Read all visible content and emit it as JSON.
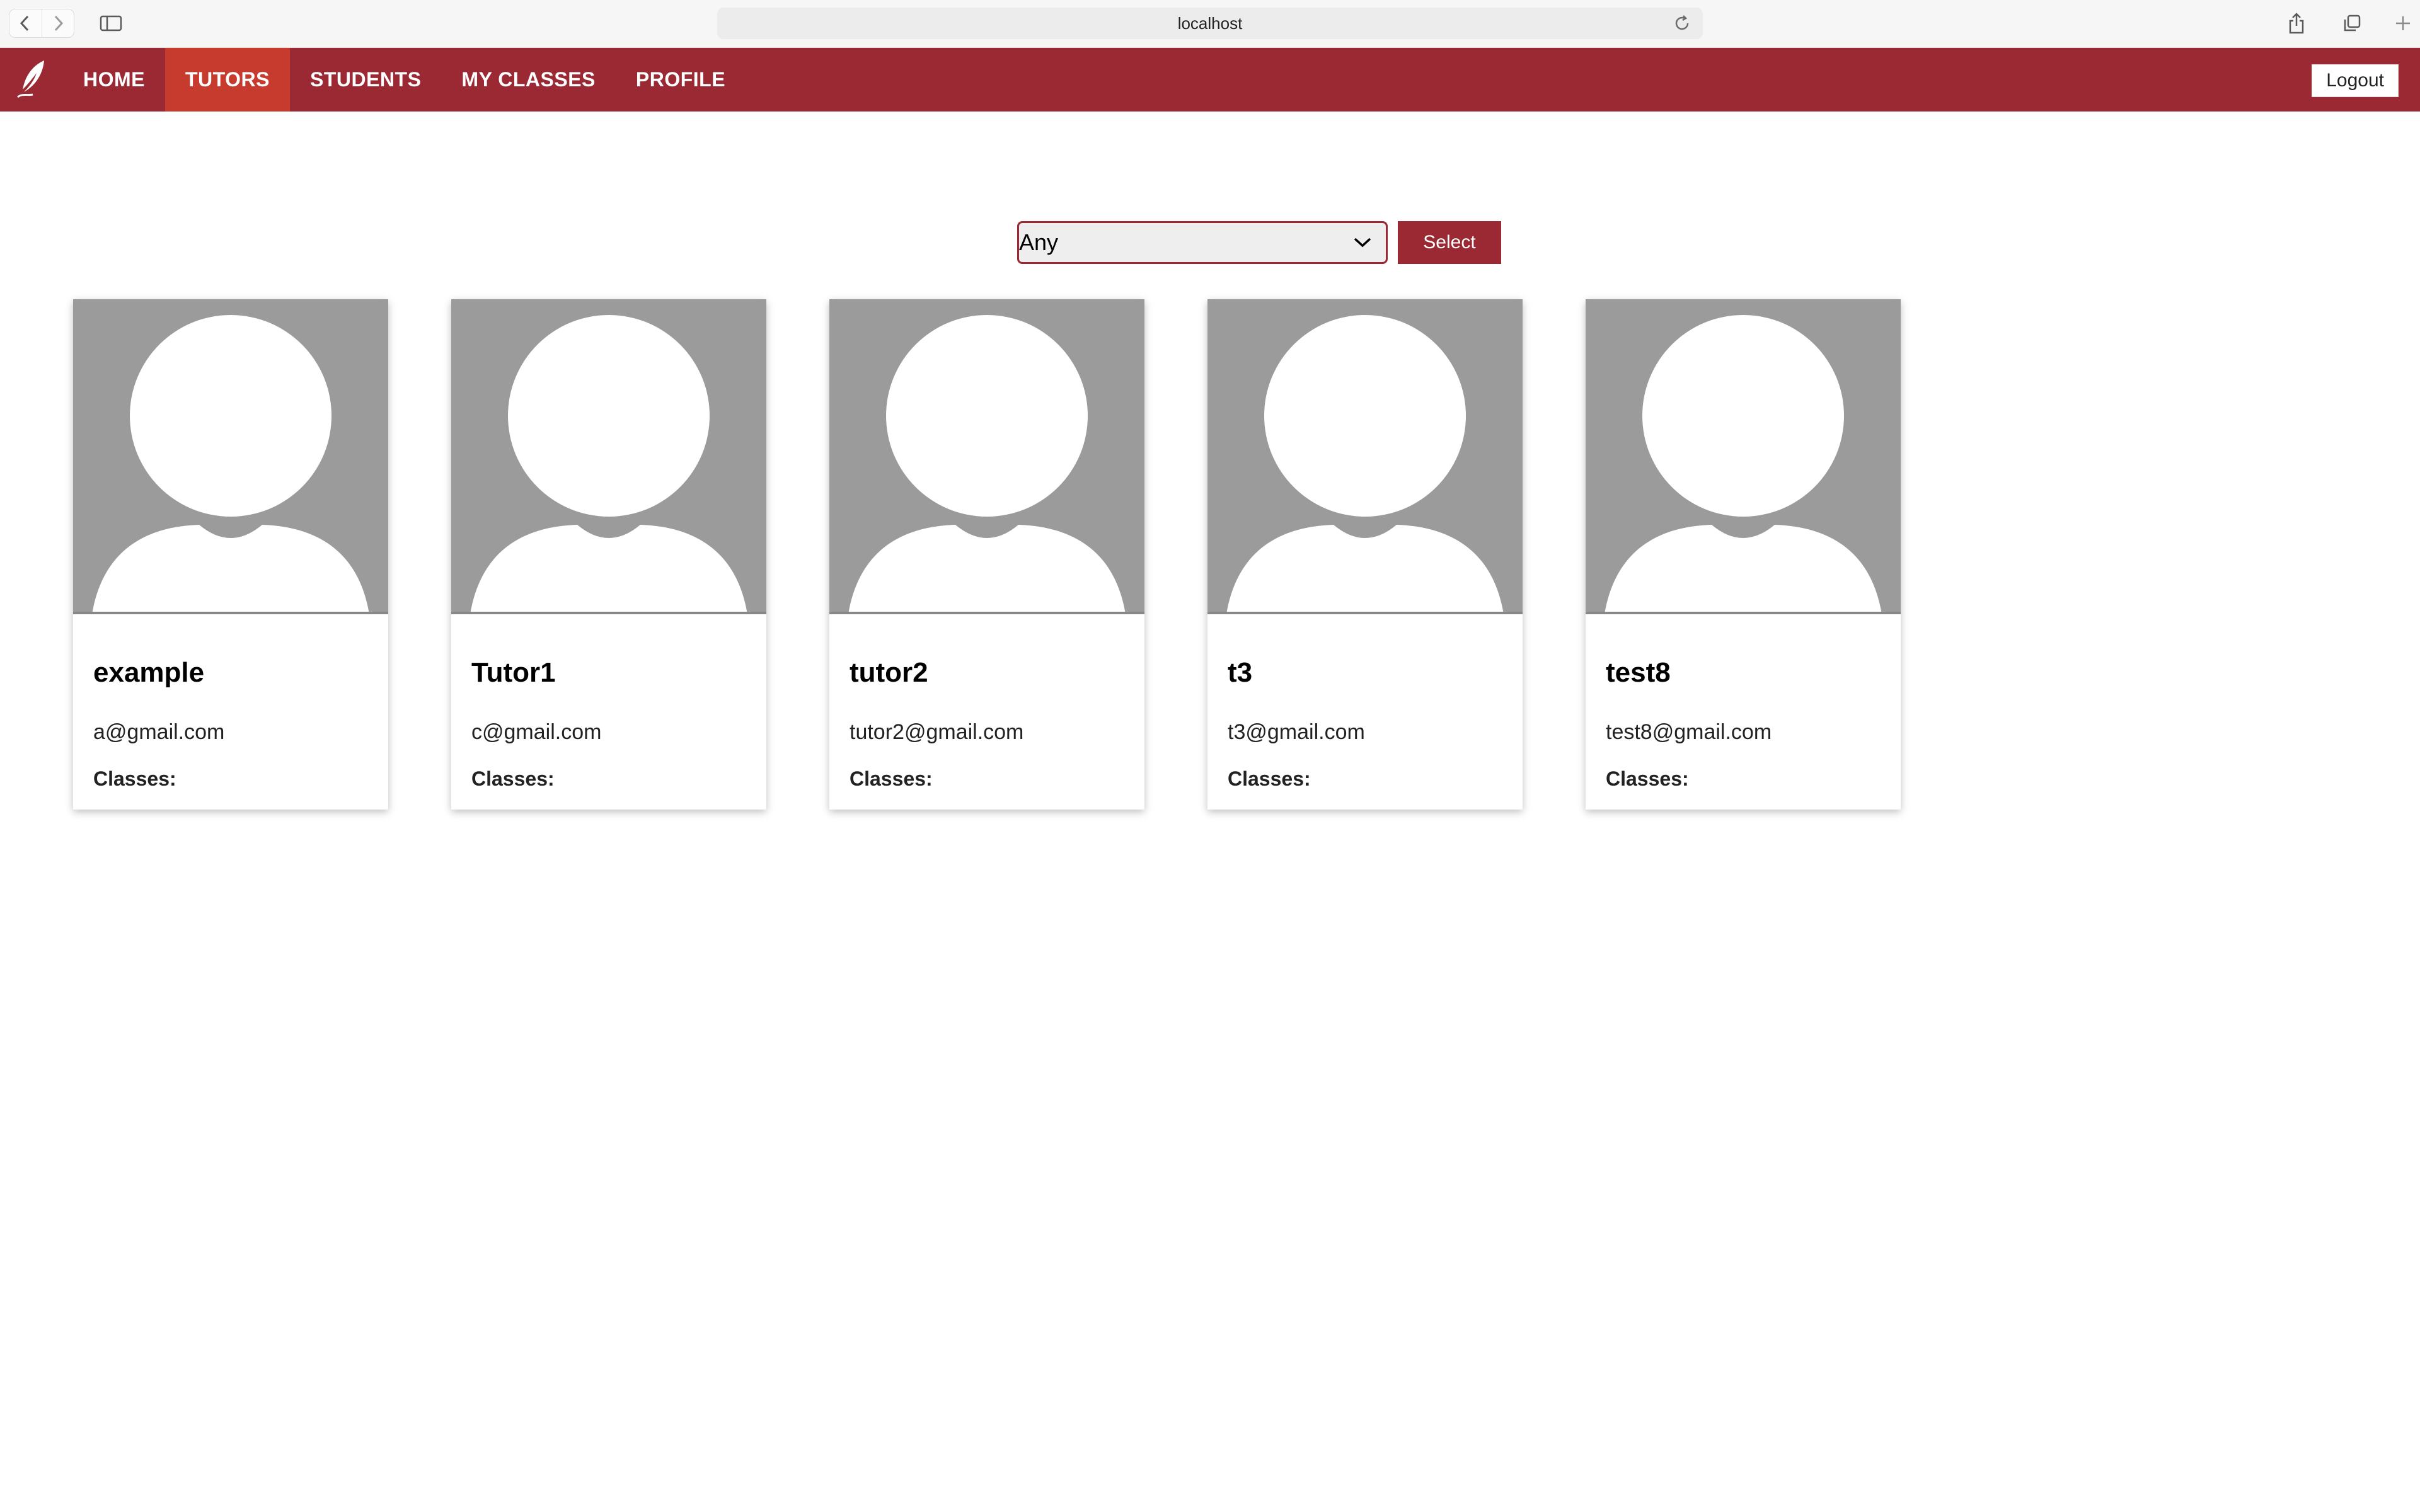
{
  "browser": {
    "url": "localhost"
  },
  "navbar": {
    "items": [
      {
        "label": "HOME",
        "active": false
      },
      {
        "label": "TUTORS",
        "active": true
      },
      {
        "label": "STUDENTS",
        "active": false
      },
      {
        "label": "MY CLASSES",
        "active": false
      },
      {
        "label": "PROFILE",
        "active": false
      }
    ],
    "logout_label": "Logout",
    "colors": {
      "bar": "#9a2933",
      "active": "#c73a2e"
    }
  },
  "filter": {
    "selected": "Any",
    "button_label": "Select"
  },
  "tutors": [
    {
      "name": "example",
      "email": "a@gmail.com",
      "classes_label": "Classes:"
    },
    {
      "name": "Tutor1",
      "email": "c@gmail.com",
      "classes_label": "Classes:"
    },
    {
      "name": "tutor2",
      "email": "tutor2@gmail.com",
      "classes_label": "Classes:"
    },
    {
      "name": "t3",
      "email": "t3@gmail.com",
      "classes_label": "Classes:"
    },
    {
      "name": "test8",
      "email": "test8@gmail.com",
      "classes_label": "Classes:"
    }
  ]
}
